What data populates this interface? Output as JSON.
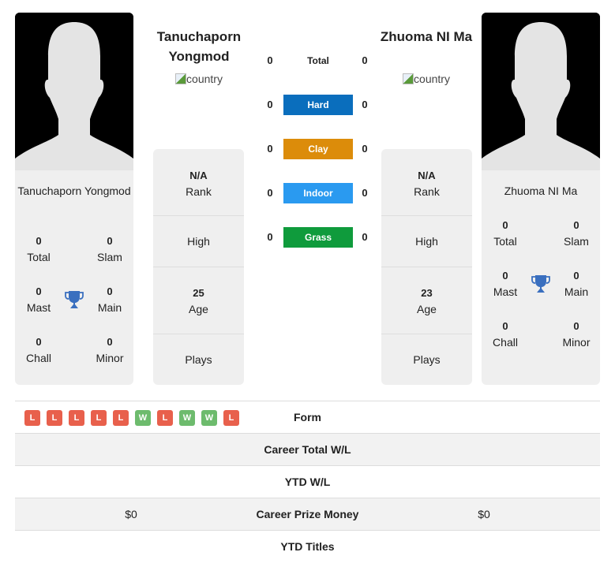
{
  "player1": {
    "name_header": "Tanuchaporn Yongmod",
    "name_card": "Tanuchaporn Yongmod",
    "flag_alt": "country",
    "titles": {
      "total": "0",
      "slam": "0",
      "mast": "0",
      "main": "0",
      "chall": "0",
      "minor": "0"
    },
    "rank": "N/A",
    "age": "25"
  },
  "player2": {
    "name_header": "Zhuoma NI Ma",
    "name_card": "Zhuoma NI Ma",
    "flag_alt": "country",
    "titles": {
      "total": "0",
      "slam": "0",
      "mast": "0",
      "main": "0",
      "chall": "0",
      "minor": "0"
    },
    "rank": "N/A",
    "age": "23"
  },
  "labels": {
    "total": "Total",
    "slam": "Slam",
    "mast": "Mast",
    "main": "Main",
    "chall": "Chall",
    "minor": "Minor",
    "rank": "Rank",
    "high": "High",
    "age": "Age",
    "plays": "Plays"
  },
  "surfaces": [
    {
      "name": "Total",
      "p1": "0",
      "p2": "0",
      "color": ""
    },
    {
      "name": "Hard",
      "p1": "0",
      "p2": "0",
      "color": "#0a6ebd"
    },
    {
      "name": "Clay",
      "p1": "0",
      "p2": "0",
      "color": "#dc8c0a"
    },
    {
      "name": "Indoor",
      "p1": "0",
      "p2": "0",
      "color": "#2a9af0"
    },
    {
      "name": "Grass",
      "p1": "0",
      "p2": "0",
      "color": "#0f9b3c"
    }
  ],
  "form": {
    "label": "Form",
    "p1": [
      "L",
      "L",
      "L",
      "L",
      "L",
      "W",
      "L",
      "W",
      "W",
      "L"
    ]
  },
  "bottom_rows": [
    {
      "label": "Career Total W/L",
      "p1": "",
      "p2": ""
    },
    {
      "label": "YTD W/L",
      "p1": "",
      "p2": ""
    },
    {
      "label": "Career Prize Money",
      "p1": "$0",
      "p2": "$0"
    },
    {
      "label": "YTD Titles",
      "p1": "",
      "p2": ""
    }
  ],
  "colors": {
    "trophy": "#3a6fbf",
    "loss": "#e8604c",
    "win": "#6dbb6d"
  }
}
